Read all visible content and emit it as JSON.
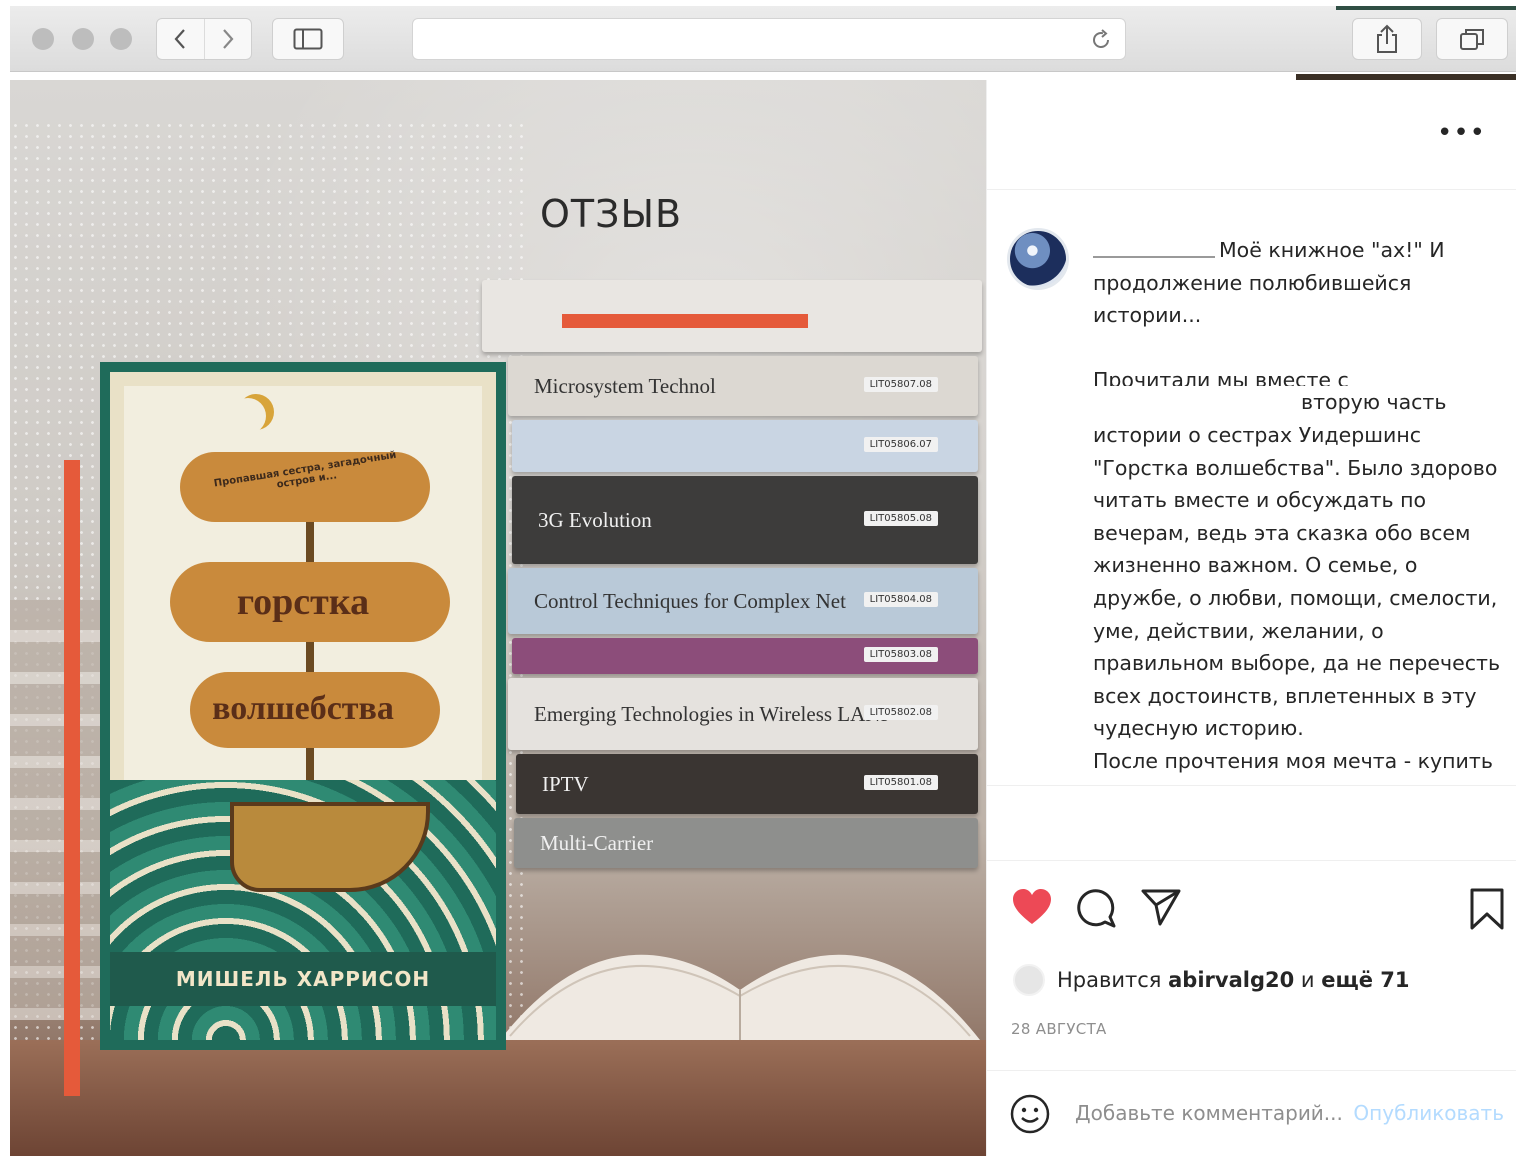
{
  "browser": {
    "address_value": "",
    "icons": {
      "back": "chevron-left-icon",
      "forward": "chevron-right-icon",
      "sidebar": "sidebar-icon",
      "reload": "reload-icon",
      "share": "share-icon",
      "tabs": "tabs-icon"
    }
  },
  "post_image": {
    "title": "ОТЗЫВ",
    "book_cover": {
      "tagline": "Пропавшая сестра, загадочный остров и...",
      "title_line1": "горстка",
      "title_line2": "волшебства",
      "author": "МИШЕЛЬ ХАРРИСОН"
    },
    "stack_books": [
      {
        "title": "",
        "tag": "",
        "color": "#e9e6e2"
      },
      {
        "title": "Microsystem Technol",
        "tag": "LIT05807.08",
        "color": "#dcd8d2"
      },
      {
        "title": "",
        "tag": "LIT05806.07",
        "color": "#c9d5e3"
      },
      {
        "title": "3G Evolution",
        "tag": "LIT05805.08",
        "color": "#3d3c3b"
      },
      {
        "title": "Control Techniques for Complex Net",
        "tag": "LIT05804.08",
        "color": "#b9c9d8"
      },
      {
        "title": "",
        "tag": "LIT05803.08",
        "color": "#8c4d7a"
      },
      {
        "title": "Emerging Technologies in Wireless LANs",
        "tag": "LIT05802.08",
        "color": "#e5e2de"
      },
      {
        "title": "IPTV",
        "tag": "LIT05801.08",
        "color": "#3a3532"
      },
      {
        "title": "Multi-Carrier",
        "tag": "",
        "color": "#8e8f8d"
      }
    ],
    "accent_color": "#e55a3a"
  },
  "post": {
    "more_label": "•••",
    "caption": {
      "line1": "Моё книжное \"ах!\" И",
      "line2": "продолжение полюбившейся",
      "line3": "истории...",
      "line4": "Прочитали мы вместе с",
      "line5": "вторую часть",
      "body": "истории о сестрах Уидершинс \"Горстка волшебства\". Было здорово читать вместе и обсуждать по вечерам, ведь эта сказка обо всем жизненно важном. О семье, о дружбе, о любви, помощи, смелости, уме, действии, желании, о правильном выборе, да не перечесть всех достоинств, вплетенных в эту чудесную историю.",
      "last_line": "После прочтения моя мечта - купить"
    },
    "actions": {
      "like": "heart-icon",
      "comment": "comment-icon",
      "share": "send-icon",
      "save": "bookmark-icon",
      "like_color": "#ed4956"
    },
    "likes": {
      "prefix": "Нравится",
      "user": "abirvalg20",
      "and": "и",
      "others": "ещё 71"
    },
    "date": "28 АВГУСТА",
    "comment": {
      "placeholder": "Добавьте комментарий...",
      "publish_label": "Опубликовать",
      "publish_color": "#b3dbff"
    }
  }
}
